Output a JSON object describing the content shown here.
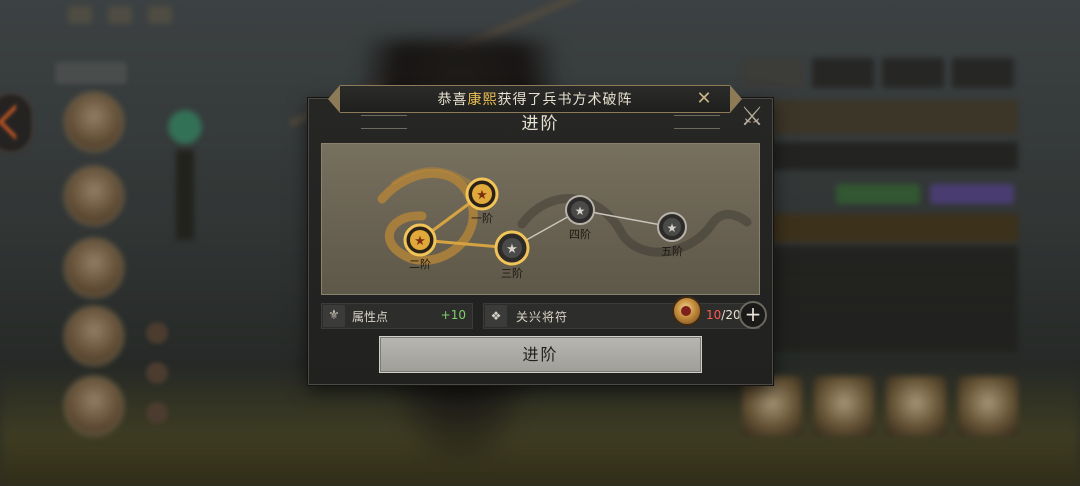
{
  "banner": {
    "text_prefix": "恭喜",
    "player_name": "康熙",
    "text_suffix": "获得了兵书方术破阵",
    "close_icon": "close-icon"
  },
  "modal": {
    "title": "进阶",
    "close_icon": "crossed-swords-close-icon"
  },
  "progression": {
    "tiers": [
      {
        "label": "一阶",
        "state": "unlocked"
      },
      {
        "label": "二阶",
        "state": "unlocked"
      },
      {
        "label": "三阶",
        "state": "next"
      },
      {
        "label": "四阶",
        "state": "locked"
      },
      {
        "label": "五阶",
        "state": "locked"
      }
    ],
    "colors": {
      "unlocked": "#e0a93a",
      "locked": "#4a4a48",
      "link_active": "#d6a242",
      "link_locked": "#c9c5bd"
    }
  },
  "stat": {
    "icon": "attribute-icon",
    "label": "属性点",
    "value": "+10"
  },
  "material": {
    "icon": "general-token-icon",
    "name": "关兴将符",
    "owned": "10",
    "separator": "/",
    "required": "20",
    "add_label": "+"
  },
  "advance_button": {
    "label": "进阶"
  }
}
